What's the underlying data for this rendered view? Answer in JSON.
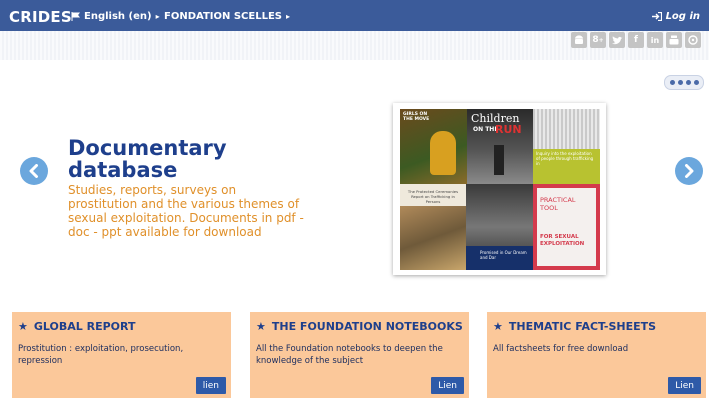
{
  "header": {
    "brand": "CRIDES",
    "language": "English (en)",
    "foundation": "FONDATION SCELLES",
    "login": "Log in"
  },
  "social": [
    "android-icon",
    "google-plus-icon",
    "twitter-icon",
    "facebook-icon",
    "linkedin-icon",
    "youtube-icon",
    "rss-icon"
  ],
  "slide": {
    "title_line1": "Documentary",
    "title_line2": "database",
    "text": "Studies, reports, surveys on prostitution and the various themes of sexual exploitation. Documents in pdf - doc - ppt available for download",
    "collage": {
      "tile1": "GIRLS ON THE MOVE",
      "tile2_a": "Children",
      "tile2_b": "ON THE",
      "tile2_c": "RUN",
      "tile3": "Inquiry into the exploitation of people through trafficking in",
      "tile4": "The Protected Ceremonies Report on Trafficking in Persons",
      "tile5": "Promised in Our Dream and Dar",
      "tool_title": "PRACTICAL TOOL",
      "tool_sub": "FOR SEXUAL EXPLOITATION"
    }
  },
  "cards": [
    {
      "title": "GLOBAL REPORT",
      "text": "Prostitution : exploitation, prosecution, repression",
      "button": "lien"
    },
    {
      "title": "THE FOUNDATION NOTEBOOKS",
      "text": "All the Foundation notebooks to deepen the knowledge of the subject",
      "button": "Lien"
    },
    {
      "title": "THEMATIC FACT-SHEETS",
      "text": "All factsheets for free download",
      "button": "Lien"
    }
  ],
  "colors": {
    "topbar": "#3b5b9a",
    "accent_blue": "#1e3f8c",
    "accent_orange": "#e0902a",
    "card_bg": "#fbc89a",
    "button": "#2e5aa8",
    "arrow": "#6ba7dd"
  }
}
